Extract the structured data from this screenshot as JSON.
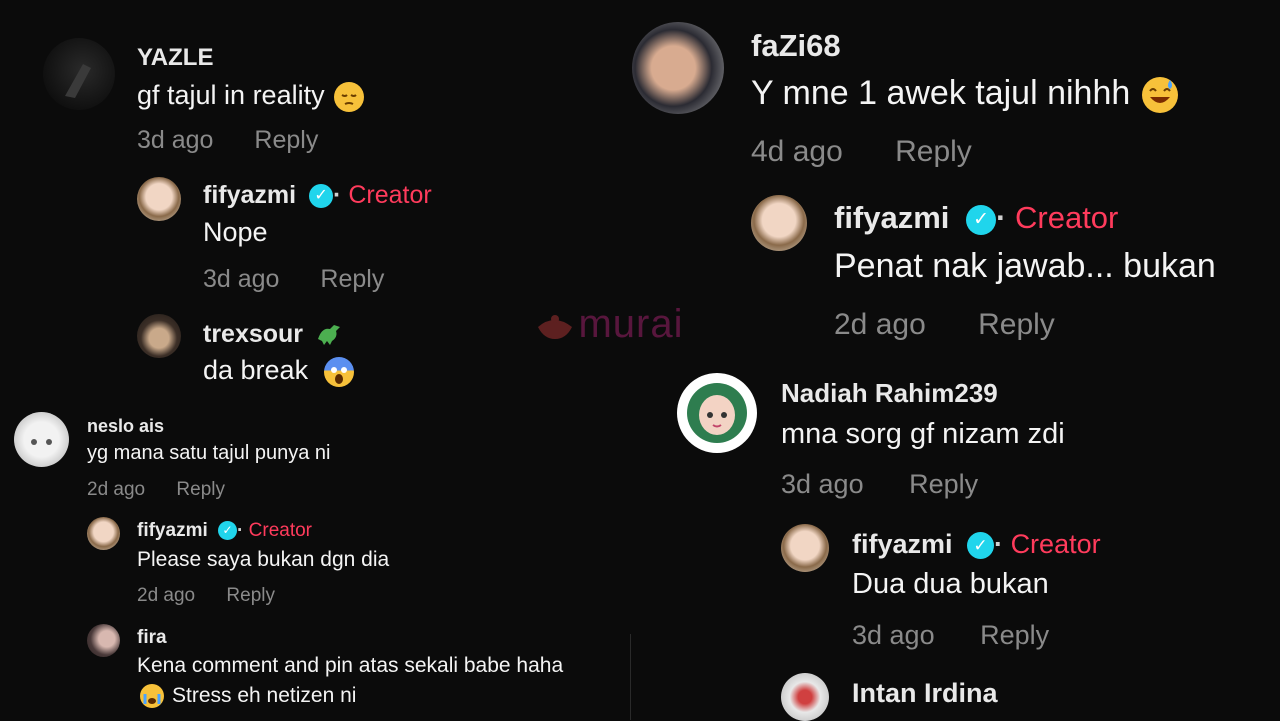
{
  "watermark": {
    "text": "murai"
  },
  "left": {
    "c1": {
      "user": "YAZLE",
      "text": "gf tajul in reality",
      "time": "3d ago",
      "reply": "Reply"
    },
    "r1": {
      "user": "fifyazmi",
      "creator": "Creator",
      "text": "Nope",
      "time": "3d ago",
      "reply": "Reply"
    },
    "r2": {
      "user": "trexsour",
      "text": "da break"
    },
    "c2": {
      "user": "neslo ais",
      "text": "yg mana satu tajul punya ni",
      "time": "2d ago",
      "reply": "Reply"
    },
    "r3": {
      "user": "fifyazmi",
      "creator": "Creator",
      "text": "Please saya bukan dgn dia",
      "time": "2d ago",
      "reply": "Reply"
    },
    "r4": {
      "user": "fira",
      "text1": "Kena comment and pin atas sekali babe haha",
      "text2": "Stress eh netizen ni"
    }
  },
  "right": {
    "c1": {
      "user": "faZi68",
      "text": "Y mne 1 awek tajul nihhh",
      "time": "4d ago",
      "reply": "Reply"
    },
    "r1": {
      "user": "fifyazmi",
      "creator": "Creator",
      "text": "Penat nak jawab... bukan",
      "time": "2d ago",
      "reply": "Reply"
    },
    "c2": {
      "user": "Nadiah Rahim239",
      "text": "mna sorg gf nizam zdi",
      "time": "3d ago",
      "reply": "Reply"
    },
    "r2": {
      "user": "fifyazmi",
      "creator": "Creator",
      "text": "Dua dua bukan",
      "time": "3d ago",
      "reply": "Reply"
    },
    "c3": {
      "user": "Intan Irdina"
    }
  },
  "colors": {
    "creator": "#ff3b5c",
    "verified": "#20d5ec",
    "muted": "#8a8a8a",
    "background": "#0b0b0b"
  }
}
